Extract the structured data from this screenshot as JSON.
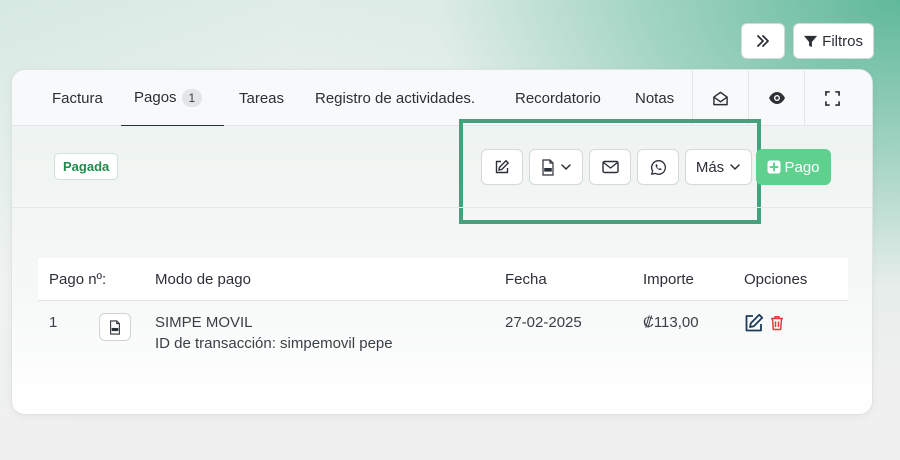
{
  "top_actions": {
    "filtros_label": "Filtros"
  },
  "tabs": [
    {
      "label": "Factura"
    },
    {
      "label": "Pagos",
      "badge": "1",
      "active": true
    },
    {
      "label": "Tareas"
    },
    {
      "label": "Registro de actividades."
    },
    {
      "label": "Recordatorio"
    },
    {
      "label": "Notas"
    }
  ],
  "status": {
    "label": "Pagada"
  },
  "toolbar": {
    "mas_label": "Más",
    "pago_label": "Pago"
  },
  "table": {
    "headers": [
      "Pago nº:",
      "Modo de pago",
      "Fecha",
      "Importe",
      "Opciones"
    ],
    "rows": [
      {
        "number": "1",
        "mode": "SIMPE MOVIL",
        "transaction": "ID de transacción: simpemovil pepe",
        "date": "27-02-2025",
        "amount": "₡113,00"
      }
    ]
  },
  "colors": {
    "accent": "#46a07c",
    "pago_button": "#5fd08e",
    "paid_text": "#1f8a4c",
    "delete": "#e03a3a",
    "edit": "#1d3a5c"
  },
  "icons": {
    "expand": "double-chevron-right-icon",
    "filter": "funnel-icon",
    "mail_open": "envelope-open-icon",
    "eye": "eye-icon",
    "fullscreen": "fullscreen-icon",
    "edit": "pencil-square-icon",
    "pdf": "pdf-file-icon",
    "mail": "envelope-icon",
    "whatsapp": "whatsapp-icon",
    "add": "plus-square-icon",
    "delete": "trash-icon"
  }
}
